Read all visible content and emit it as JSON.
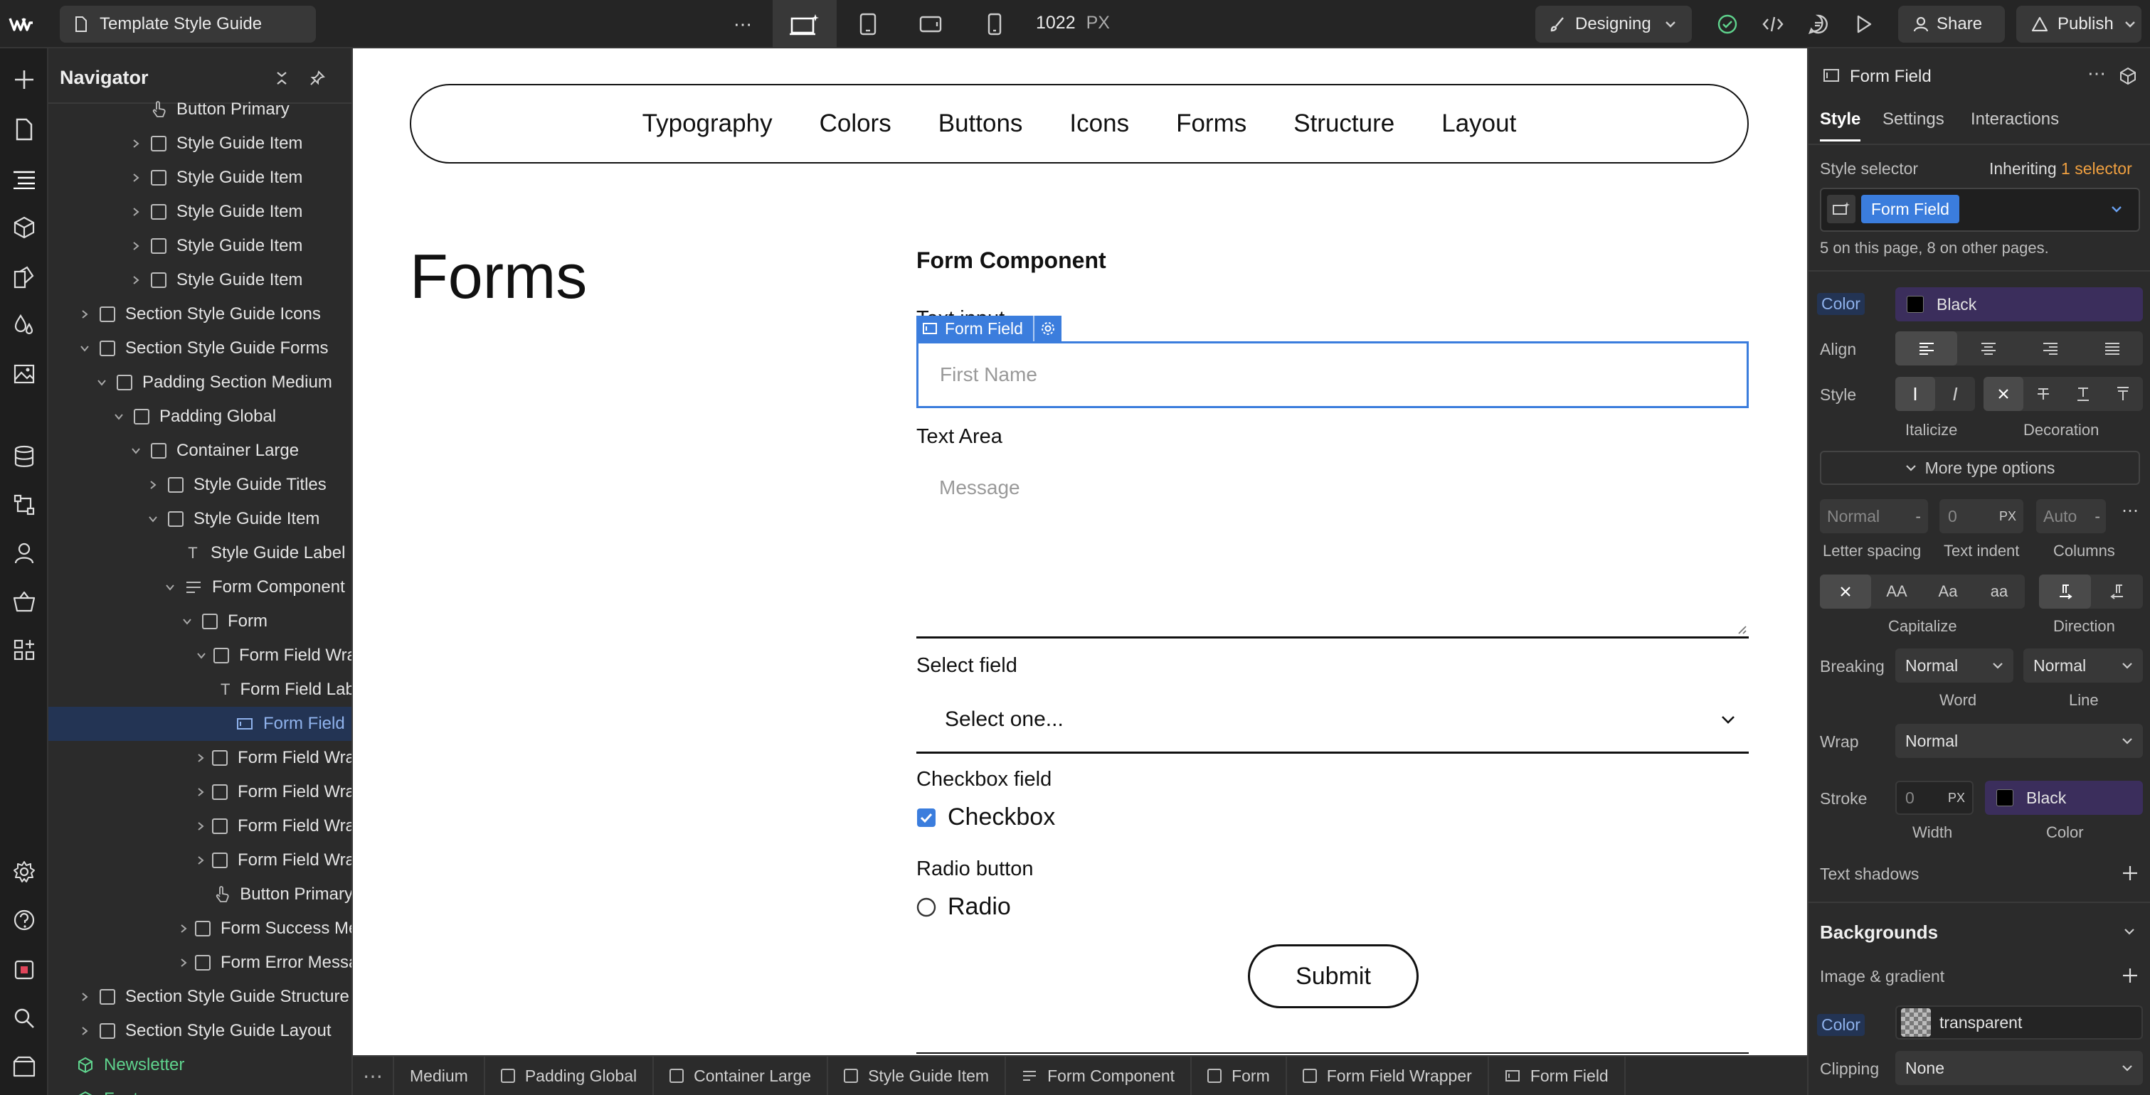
{
  "topbar": {
    "page_name": "Template Style Guide",
    "width_value": "1022",
    "width_unit": "PX",
    "mode": "Designing",
    "share": "Share",
    "publish": "Publish"
  },
  "navigator": {
    "title": "Navigator",
    "rows": [
      {
        "label": "Button Primary",
        "indent": 3,
        "kind": "hand",
        "caret": false
      },
      {
        "label": "Style Guide Item",
        "indent": 3,
        "kind": "box",
        "caret": "right"
      },
      {
        "label": "Style Guide Item",
        "indent": 3,
        "kind": "box",
        "caret": "right"
      },
      {
        "label": "Style Guide Item",
        "indent": 3,
        "kind": "box",
        "caret": "right"
      },
      {
        "label": "Style Guide Item",
        "indent": 3,
        "kind": "box",
        "caret": "right"
      },
      {
        "label": "Style Guide Item",
        "indent": 3,
        "kind": "box",
        "caret": "right"
      },
      {
        "label": "Section Style Guide Icons",
        "indent": 0,
        "kind": "box",
        "caret": "right"
      },
      {
        "label": "Section Style Guide Forms",
        "indent": 0,
        "kind": "box",
        "caret": "down"
      },
      {
        "label": "Padding Section Medium",
        "indent": 1,
        "kind": "box",
        "caret": "down"
      },
      {
        "label": "Padding Global",
        "indent": 2,
        "kind": "box",
        "caret": "down"
      },
      {
        "label": "Container Large",
        "indent": 3,
        "kind": "box",
        "caret": "down"
      },
      {
        "label": "Style Guide Titles",
        "indent": 4,
        "kind": "box",
        "caret": "right"
      },
      {
        "label": "Style Guide Item",
        "indent": 4,
        "kind": "box",
        "caret": "down"
      },
      {
        "label": "Style Guide Label",
        "indent": 5,
        "kind": "text",
        "caret": false
      },
      {
        "label": "Form Component",
        "indent": 5,
        "kind": "form",
        "caret": "down"
      },
      {
        "label": "Form",
        "indent": 6,
        "kind": "box",
        "caret": "down"
      },
      {
        "label": "Form Field Wrapper",
        "indent": 7,
        "kind": "box",
        "caret": "down"
      },
      {
        "label": "Form Field Label",
        "indent": 8,
        "kind": "text",
        "caret": false
      },
      {
        "label": "Form Field",
        "indent": 8,
        "kind": "input",
        "caret": false,
        "selected": true
      },
      {
        "label": "Form Field Wrapper",
        "indent": 7,
        "kind": "box",
        "caret": "right"
      },
      {
        "label": "Form Field Wrapper",
        "indent": 7,
        "kind": "box",
        "caret": "right"
      },
      {
        "label": "Form Field Wrapper",
        "indent": 7,
        "kind": "box",
        "caret": "right"
      },
      {
        "label": "Form Field Wrapper",
        "indent": 7,
        "kind": "box",
        "caret": "right"
      },
      {
        "label": "Button Primary",
        "indent": 7,
        "kind": "hand",
        "caret": false
      },
      {
        "label": "Form Success Message",
        "indent": 6,
        "kind": "box",
        "caret": "right"
      },
      {
        "label": "Form Error Message",
        "indent": 6,
        "kind": "box",
        "caret": "right"
      },
      {
        "label": "Section Style Guide Structure",
        "indent": 0,
        "kind": "box",
        "caret": "right"
      },
      {
        "label": "Section Style Guide Layout",
        "indent": 0,
        "kind": "box",
        "caret": "right"
      },
      {
        "label": "Newsletter",
        "indent": -1,
        "kind": "component",
        "caret": false
      },
      {
        "label": "Footer",
        "indent": -1,
        "kind": "component",
        "caret": false
      }
    ]
  },
  "canvas": {
    "nav_links": [
      "Typography",
      "Colors",
      "Buttons",
      "Icons",
      "Forms",
      "Structure",
      "Layout"
    ],
    "section_title": "Forms",
    "component_title": "Form Component",
    "text_input_label_partial": "Text input",
    "selected_badge": "Form Field",
    "text_input_placeholder": "First Name",
    "textarea_label": "Text Area",
    "textarea_placeholder": "Message",
    "select_label": "Select field",
    "select_value": "Select one...",
    "checkbox_label": "Checkbox field",
    "checkbox_text": "Checkbox",
    "radio_label": "Radio button",
    "radio_text": "Radio",
    "submit": "Submit"
  },
  "panel": {
    "element_name": "Form Field",
    "tabs": [
      "Style",
      "Settings",
      "Interactions"
    ],
    "style_selector_label": "Style selector",
    "inheriting_text": "Inheriting",
    "inheriting_link": "1 selector",
    "selector_chip": "Form Field",
    "usage_text": "5 on this page, 8 on other pages.",
    "color_label": "Color",
    "color_value": "Black",
    "align_label": "Align",
    "style_label": "Style",
    "italicize_label": "Italicize",
    "decoration_label": "Decoration",
    "more_type": "More type options",
    "letter_spacing_value": "Normal",
    "letter_spacing_label": "Letter spacing",
    "text_indent_value": "0",
    "text_indent_unit": "PX",
    "text_indent_label": "Text indent",
    "columns_value": "Auto",
    "columns_label": "Columns",
    "cap_options": [
      "AA",
      "Aa",
      "aa"
    ],
    "capitalize_label": "Capitalize",
    "direction_label": "Direction",
    "breaking_label": "Breaking",
    "word_value": "Normal",
    "line_value": "Normal",
    "word_label": "Word",
    "line_label": "Line",
    "wrap_label": "Wrap",
    "wrap_value": "Normal",
    "stroke_label": "Stroke",
    "stroke_width_value": "0",
    "stroke_unit": "PX",
    "stroke_color": "Black",
    "width_label": "Width",
    "color_sub_label": "Color",
    "text_shadows": "Text shadows",
    "backgrounds": "Backgrounds",
    "image_gradient": "Image & gradient",
    "bg_color_label": "Color",
    "bg_color_value": "transparent",
    "clipping_label": "Clipping",
    "clipping_value": "None"
  },
  "breadcrumb": [
    "Medium",
    "Padding Global",
    "Container Large",
    "Style Guide Item",
    "Form Component",
    "Form",
    "Form Field Wrapper",
    "Form Field"
  ],
  "colors": {
    "accent": "#3b7ddd",
    "selection_bg": "#233454",
    "inherit_link": "#f0a040",
    "chip_purple": "#3b2e5c",
    "component_green": "#5fd38d"
  }
}
